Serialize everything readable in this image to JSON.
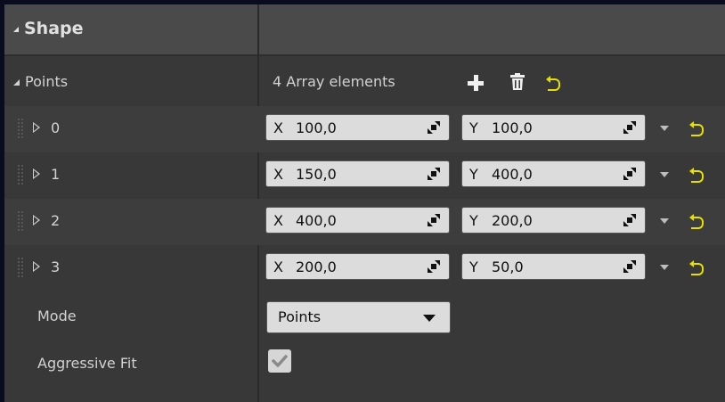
{
  "header": {
    "title": "Shape"
  },
  "points": {
    "label": "Points",
    "summary": "4 Array elements",
    "add_icon": "plus-icon",
    "delete_icon": "trash-icon",
    "reset_icon": "reset-arrow-icon"
  },
  "elements": [
    {
      "index": "0",
      "x_label": "X",
      "x": "100,0",
      "y_label": "Y",
      "y": "100,0"
    },
    {
      "index": "1",
      "x_label": "X",
      "x": "150,0",
      "y_label": "Y",
      "y": "400,0"
    },
    {
      "index": "2",
      "x_label": "X",
      "x": "400,0",
      "y_label": "Y",
      "y": "200,0"
    },
    {
      "index": "3",
      "x_label": "X",
      "x": "200,0",
      "y_label": "Y",
      "y": "50,0"
    }
  ],
  "mode": {
    "label": "Mode",
    "value": "Points"
  },
  "aggressive_fit": {
    "label": "Aggressive Fit",
    "checked": true
  },
  "colors": {
    "reset": "#e6e000",
    "panel": "#383838",
    "header": "#4a4a4a",
    "field": "#dcdcdc"
  }
}
